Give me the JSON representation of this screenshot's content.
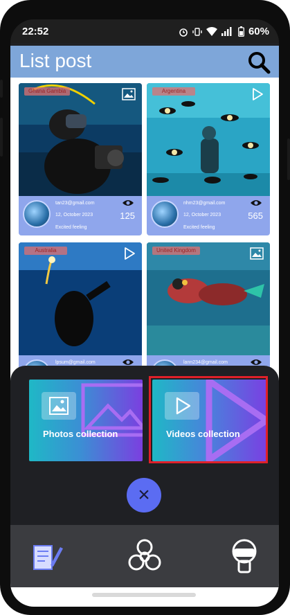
{
  "status": {
    "time": "22:52",
    "battery": "60%"
  },
  "app": {
    "title": "List post"
  },
  "posts": [
    {
      "chip": "Ghana Gambia",
      "email": "tan23@gmail.com",
      "date": "12, October 2023",
      "feeling": "Excited feeling",
      "views": "125",
      "media": "photo"
    },
    {
      "chip": "Argentina",
      "email": "nhm23@gmail.com",
      "date": "12, October 2023",
      "feeling": "Excited feeling",
      "views": "565",
      "media": "video"
    },
    {
      "chip": "Australia",
      "email": "lpsum@gmail.com",
      "date": "",
      "feeling": "",
      "views": "",
      "media": "video"
    },
    {
      "chip": "United Kingdom",
      "email": "lann234@gmail.com",
      "date": "",
      "feeling": "",
      "views": "",
      "media": "photo"
    }
  ],
  "sheet": {
    "photos_label": "Photos collection",
    "videos_label": "Videos collection",
    "close_symbol": "×"
  },
  "nav": {
    "items": [
      "document-edit-icon",
      "biohazard-icon",
      "diver-mask-icon"
    ]
  },
  "colors": {
    "appbar": "#7ea6d9",
    "card_footer": "#8fa6ec",
    "close_button": "#5b6cf2",
    "highlight": "#e0202a"
  }
}
